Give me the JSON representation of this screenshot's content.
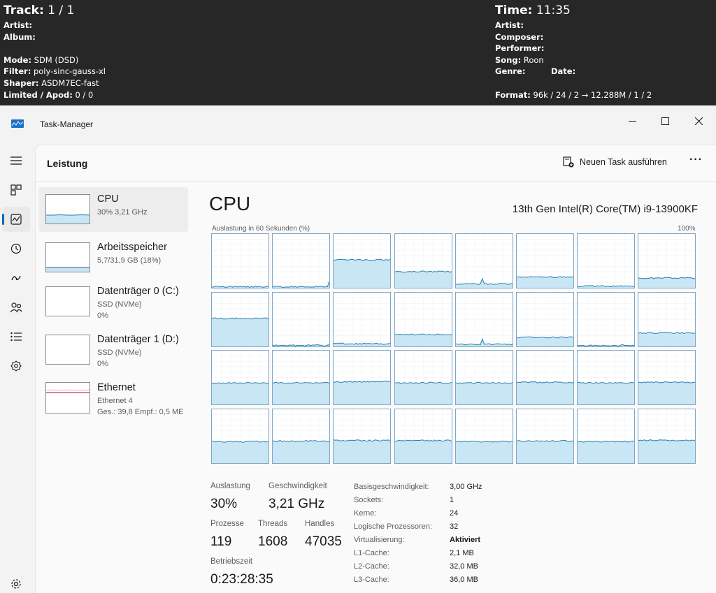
{
  "player_info": {
    "left": {
      "track_label": "Track:",
      "track_value": "1 / 1",
      "artist_label": "Artist:",
      "album_label": "Album:",
      "mode_label": "Mode:",
      "mode_value": "SDM (DSD)",
      "filter_label": "Filter:",
      "filter_value": "poly-sinc-gauss-xl",
      "shaper_label": "Shaper:",
      "shaper_value": "ASDM7EC-fast",
      "limited_label": "Limited / Apod:",
      "limited_value": "0 / 0"
    },
    "right": {
      "time_label": "Time:",
      "time_value": "11:35",
      "artist_label": "Artist:",
      "composer_label": "Composer:",
      "performer_label": "Performer:",
      "song_label": "Song:",
      "song_value": "Roon",
      "genre_label": "Genre:",
      "date_label": "Date:",
      "format_label": "Format:",
      "format_value": "96k / 24 / 2 → 12.288M / 1 / 2"
    }
  },
  "window": {
    "title": "Task-Manager",
    "minimize_icon": "minimize-icon",
    "maximize_icon": "maximize-icon",
    "close_icon": "close-icon"
  },
  "nav": [
    {
      "icon": "hamburger-menu-icon"
    },
    {
      "icon": "processes-icon"
    },
    {
      "icon": "performance-icon",
      "selected": true
    },
    {
      "icon": "app-history-icon"
    },
    {
      "icon": "startup-apps-icon"
    },
    {
      "icon": "users-icon"
    },
    {
      "icon": "details-icon"
    },
    {
      "icon": "services-icon"
    },
    {
      "icon": "settings-icon"
    }
  ],
  "header": {
    "title": "Leistung",
    "new_task_label": "Neuen Task ausführen",
    "more_label": "···"
  },
  "resources": [
    {
      "name": "CPU",
      "sub1": "30%  3,21 GHz",
      "sub2": "",
      "selected": true
    },
    {
      "name": "Arbeitsspeicher",
      "sub1": "5,7/31,9 GB (18%)",
      "sub2": ""
    },
    {
      "name": "Datenträger 0 (C:)",
      "sub1": "SSD (NVMe)",
      "sub2": "0%"
    },
    {
      "name": "Datenträger 1 (D:)",
      "sub1": "SSD (NVMe)",
      "sub2": "0%"
    },
    {
      "name": "Ethernet",
      "sub1": "Ethernet 4",
      "sub2": "Ges.: 39,8  Empf.: 0,5 ME"
    }
  ],
  "cpu": {
    "heading": "CPU",
    "model": "13th Gen Intel(R) Core(TM) i9-13900KF",
    "graph_label": "Auslastung in 60 Sekunden (%)",
    "graph_max": "100%",
    "core_utilization": [
      0.02,
      0.02,
      0.52,
      0.3,
      0.07,
      0.2,
      0.03,
      0.18,
      0.52,
      0.02,
      0.05,
      0.22,
      0.04,
      0.17,
      0.02,
      0.25,
      0.4,
      0.4,
      0.42,
      0.4,
      0.4,
      0.41,
      0.4,
      0.41,
      0.4,
      0.41,
      0.42,
      0.42,
      0.4,
      0.41,
      0.4,
      0.42
    ],
    "stats": {
      "utilization_label": "Auslastung",
      "utilization_value": "30%",
      "speed_label": "Geschwindigkeit",
      "speed_value": "3,21 GHz",
      "processes_label": "Prozesse",
      "processes_value": "119",
      "threads_label": "Threads",
      "threads_value": "1608",
      "handles_label": "Handles",
      "handles_value": "47035",
      "uptime_label": "Betriebszeit",
      "uptime_value": "0:23:28:35"
    },
    "specs": [
      {
        "key": "Basisgeschwindigkeit:",
        "value": "3,00 GHz"
      },
      {
        "key": "Sockets:",
        "value": "1"
      },
      {
        "key": "Kerne:",
        "value": "24"
      },
      {
        "key": "Logische Prozessoren:",
        "value": "32"
      },
      {
        "key": "Virtualisierung:",
        "value": "Aktiviert",
        "bold": true
      },
      {
        "key": "L1-Cache:",
        "value": "2,1 MB"
      },
      {
        "key": "L2-Cache:",
        "value": "32,0 MB"
      },
      {
        "key": "L3-Cache:",
        "value": "36,0 MB"
      }
    ]
  },
  "colors": {
    "graph_line": "#2a7db0",
    "graph_fill": "#c9e6f5",
    "graph_border": "#7ea6c7",
    "memory_line": "#5a6fc0",
    "ethernet_line": "#c0395a",
    "accent": "#0067c0"
  }
}
